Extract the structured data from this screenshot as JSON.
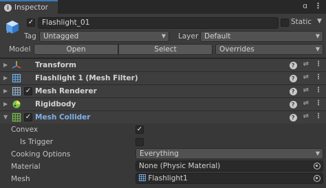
{
  "tab": {
    "title": "Inspector"
  },
  "object": {
    "name": "Flashlight_01",
    "active": true,
    "static_label": "Static",
    "static": false,
    "tag_label": "Tag",
    "tag_value": "Untagged",
    "layer_label": "Layer",
    "layer_value": "Default",
    "model_label": "Model",
    "open_label": "Open",
    "select_label": "Select",
    "overrides_label": "Overrides"
  },
  "components": [
    {
      "name": "Transform",
      "icon": "transform-icon",
      "checkbox": false
    },
    {
      "name": "Flashlight 1 (Mesh Filter)",
      "icon": "mesh-filter-icon",
      "checkbox": false
    },
    {
      "name": "Mesh Renderer",
      "icon": "mesh-renderer-icon",
      "checkbox": true,
      "checked": true
    },
    {
      "name": "Rigidbody",
      "icon": "rigidbody-icon",
      "checkbox": false
    },
    {
      "name": "Mesh Collider",
      "icon": "mesh-collider-icon",
      "checkbox": true,
      "checked": true,
      "expanded": true
    }
  ],
  "collider": {
    "convex_label": "Convex",
    "convex": true,
    "is_trigger_label": "Is Trigger",
    "is_trigger": false,
    "cooking_label": "Cooking Options",
    "cooking_value": "Everything",
    "material_label": "Material",
    "material_value": "None (Physic Material)",
    "mesh_label": "Mesh",
    "mesh_value": "Flashlight1"
  },
  "colors": {
    "accent": "#3a79bb",
    "header_bg": "#3c3c3c",
    "panel_bg": "#383838",
    "collider_name": "#7fb1e8"
  }
}
